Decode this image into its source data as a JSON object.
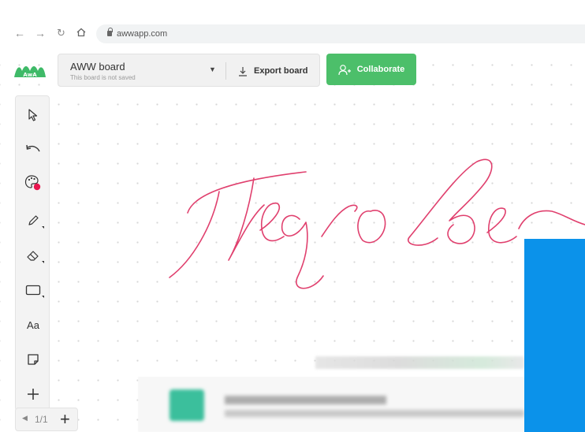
{
  "browser": {
    "url": "awwapp.com",
    "icons": [
      "back-arrow-icon",
      "forward-arrow-icon",
      "reload-icon",
      "home-icon",
      "lock-icon"
    ]
  },
  "board": {
    "name": "AWW board",
    "status": "This board is not saved",
    "export_label": "Export board",
    "collaborate_label": "Collaborate",
    "collaborate_color": "#4cbf6a"
  },
  "toolbar": {
    "tools": [
      {
        "name": "select",
        "icon": "cursor-arrow-icon"
      },
      {
        "name": "undo",
        "icon": "undo-icon"
      },
      {
        "name": "color",
        "icon": "palette-icon",
        "selected_color": "#e8164f"
      },
      {
        "name": "pen",
        "icon": "pencil-icon"
      },
      {
        "name": "eraser",
        "icon": "eraser-icon"
      },
      {
        "name": "shape",
        "icon": "rectangle-icon"
      },
      {
        "name": "text",
        "label": "Aa"
      },
      {
        "name": "sticky",
        "icon": "sticky-note-icon"
      },
      {
        "name": "more",
        "icon": "plus-icon"
      }
    ]
  },
  "pager": {
    "page": "1/1"
  },
  "drawing": {
    "stroke_color": "#e0406e"
  },
  "overlay_color": "#0b92ea"
}
